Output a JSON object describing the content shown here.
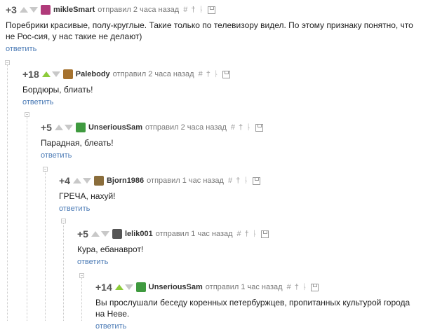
{
  "comments": [
    {
      "score": "+3",
      "username": "mikleSmart",
      "meta": "отправил 2 часа назад",
      "text": "Поребрики красивые, полу-круглые. Такие только по телевизору видел. По этому признаку понятно, что не Рос-сия, у нас такие не делают)",
      "reply": "ответить",
      "upvoted": false,
      "avatar_color": "#b03a7a"
    },
    {
      "score": "+18",
      "username": "Palebody",
      "meta": "отправил 2 часа назад",
      "text": "Бордюры, блиать!",
      "reply": "ответить",
      "upvoted": true,
      "avatar_color": "#a5722f"
    },
    {
      "score": "+5",
      "username": "UnseriousSam",
      "meta": "отправил 2 часа назад",
      "text": "Парадная, блеать!",
      "reply": "ответить",
      "upvoted": false,
      "avatar_color": "#3f9a3f"
    },
    {
      "score": "+4",
      "username": "Bjorn1986",
      "meta": "отправил 1 час назад",
      "text": "ГРЕЧА, нахуй!",
      "reply": "ответить",
      "upvoted": false,
      "avatar_color": "#8a6d3b"
    },
    {
      "score": "+5",
      "username": "lelik001",
      "meta": "отправил 1 час назад",
      "text": "Кура, ебанаврот!",
      "reply": "ответить",
      "upvoted": false,
      "avatar_color": "#555555"
    },
    {
      "score": "+14",
      "username": "UnseriousSam",
      "meta": "отправил 1 час назад",
      "text": "Вы прослушали беседу коренных петербуржцев, пропитанных культурой города на Неве.",
      "reply": "ответить",
      "upvoted": true,
      "avatar_color": "#3f9a3f"
    }
  ],
  "icons": [
    "hash-icon",
    "pin-icon",
    "branch-icon",
    "save-icon"
  ],
  "colors": {
    "upvote": "#8ccb3a",
    "link": "#4a7ab5",
    "muted": "#777777"
  }
}
